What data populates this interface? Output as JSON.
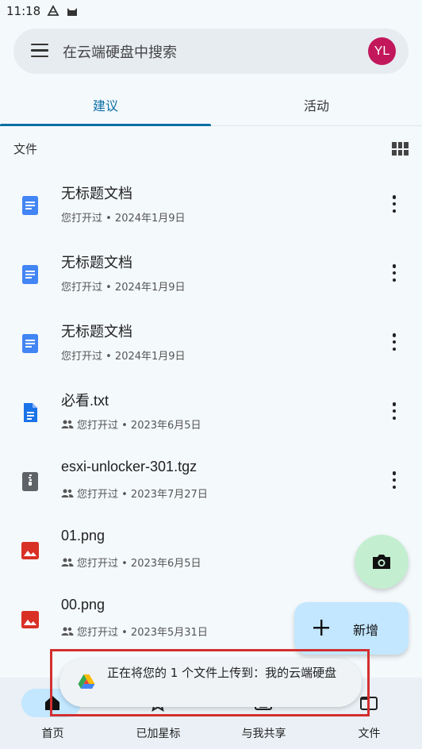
{
  "status_bar": {
    "time": "11:18"
  },
  "search": {
    "placeholder": "在云端硬盘中搜索",
    "avatar_initials": "YL",
    "avatar_color": "#c2185b"
  },
  "tabs": [
    {
      "label": "建议",
      "active": true
    },
    {
      "label": "活动",
      "active": false
    }
  ],
  "section": {
    "label": "文件"
  },
  "files": [
    {
      "name": "无标题文档",
      "meta": "您打开过 • 2024年1月9日",
      "icon": "google-doc-icon",
      "shared": false
    },
    {
      "name": "无标题文档",
      "meta": "您打开过 • 2024年1月9日",
      "icon": "google-doc-icon",
      "shared": false
    },
    {
      "name": "无标题文档",
      "meta": "您打开过 • 2024年1月9日",
      "icon": "google-doc-icon",
      "shared": false
    },
    {
      "name": "必看.txt",
      "meta": "您打开过 • 2023年6月5日",
      "icon": "text-file-icon",
      "shared": true
    },
    {
      "name": "esxi-unlocker-301.tgz",
      "meta": "您打开过 • 2023年7月27日",
      "icon": "archive-file-icon",
      "shared": true
    },
    {
      "name": "01.png",
      "meta": "您打开过 • 2023年6月5日",
      "icon": "image-file-icon",
      "shared": true
    },
    {
      "name": "00.png",
      "meta": "您打开过 • 2023年5月31日",
      "icon": "image-file-icon",
      "shared": true
    }
  ],
  "fab": {
    "new_label": "新增"
  },
  "bottom_nav": [
    {
      "label": "首页",
      "active": true
    },
    {
      "label": "已加星标",
      "active": false
    },
    {
      "label": "与我共享",
      "active": false
    },
    {
      "label": "文件",
      "active": false
    }
  ],
  "toast": {
    "text": "正在将您的 1 个文件上传到：我的云端硬盘"
  },
  "colors": {
    "accent": "#0b6fa4",
    "doc_blue": "#4285f4",
    "image_red": "#d93025",
    "highlight": "#d32f2f"
  }
}
